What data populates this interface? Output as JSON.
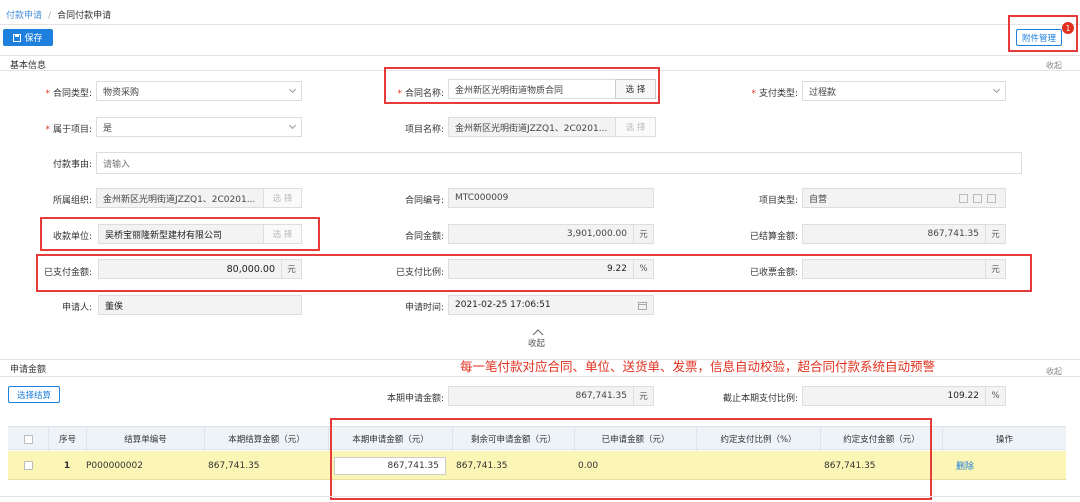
{
  "breadcrumb": {
    "parent": "付款申请",
    "separator": "/",
    "current": "合同付款申请"
  },
  "toolbar": {
    "save_label": "保存",
    "attachment_label": "附件管理",
    "attachment_badge": "1"
  },
  "basic_info": {
    "title": "基本信息",
    "collapse_label": "收起",
    "contract_type": {
      "label": "合同类型:",
      "value": "物资采购"
    },
    "contract_name": {
      "label": "合同名称:",
      "value": "金州新区光明街道物质合同",
      "button": "选 择"
    },
    "payment_type": {
      "label": "支付类型:",
      "value": "过程款"
    },
    "is_project": {
      "label": "属于项目:",
      "value": "是"
    },
    "project_name": {
      "label": "项目名称:",
      "value": "金州新区光明街道JZZQ1、2C0201...",
      "button": "选 择"
    },
    "payment_reason": {
      "label": "付款事由:",
      "placeholder": "请输入"
    },
    "org": {
      "label": "所属组织:",
      "value": "金州新区光明街道JZZQ1、2C0201...",
      "button": "选 择"
    },
    "contract_no": {
      "label": "合同编号:",
      "value": "MTC000009"
    },
    "project_kind": {
      "label": "项目类型:",
      "value": "自营"
    },
    "payee": {
      "label": "收款单位:",
      "value": "吴桥宝丽隆新型建材有限公司",
      "button": "选 择"
    },
    "contract_amount": {
      "label": "合同金额:",
      "value": "3,901,000.00",
      "unit": "元"
    },
    "settled_amount": {
      "label": "已结算金额:",
      "value": "867,741.35",
      "unit": "元"
    },
    "paid_amount": {
      "label": "已支付金额:",
      "value": "80,000.00",
      "unit": "元"
    },
    "paid_ratio": {
      "label": "已支付比例:",
      "value": "9.22",
      "unit": "%"
    },
    "invoice_amount": {
      "label": "已收票金额:",
      "value": "",
      "unit": "元"
    },
    "applicant": {
      "label": "申请人:",
      "value": "董俟"
    },
    "apply_time": {
      "label": "申请时间:",
      "value": "2021-02-25 17:06:51"
    },
    "fold_label": "收起"
  },
  "annotation": "每一笔付款对应合同、单位、送货单、发票，信息自动校验，超合同付款系统自动预警",
  "apply_amount": {
    "title": "申请金额",
    "collapse_label": "收起",
    "select_button": "选择结算",
    "current_apply": {
      "label": "本期申请金额:",
      "value": "867,741.35",
      "unit": "元"
    },
    "cutoff_ratio": {
      "label": "截止本期支付比例:",
      "value": "109.22",
      "unit": "%"
    }
  },
  "table": {
    "headers": [
      "序号",
      "结算单编号",
      "本期结算金额（元）",
      "本期申请金额（元）",
      "剩余可申请金额（元）",
      "已申请金额（元）",
      "约定支付比例（%）",
      "约定支付金额（元）",
      "操作"
    ],
    "rows": [
      {
        "index": "1",
        "settlement_no": "P000000002",
        "settle_amount": "867,741.35",
        "apply_amount": "867,741.35",
        "remaining": "867,741.35",
        "applied": "0.00",
        "ratio": "",
        "agreed_amount": "867,741.35",
        "action": "删除"
      }
    ]
  },
  "colors": {
    "accent": "#1e7fdc",
    "highlight_row": "#fbf5b6",
    "annotation_red": "#e0301e"
  }
}
